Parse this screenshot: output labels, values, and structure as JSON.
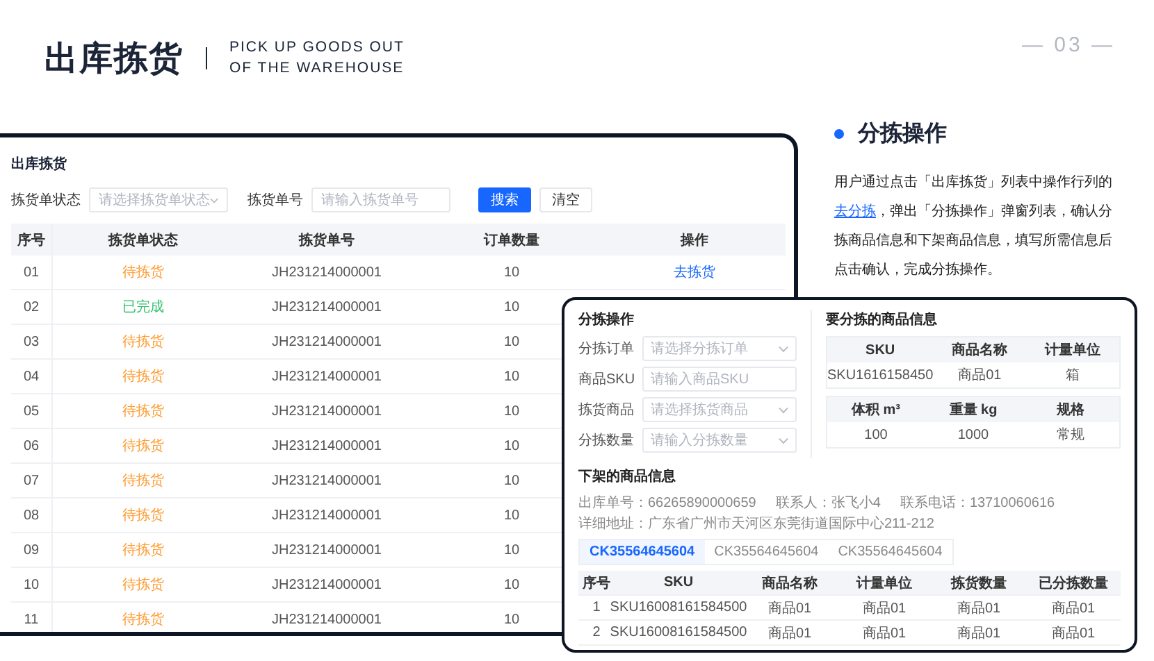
{
  "header": {
    "title": "出库拣货",
    "subtitle_lines": [
      "PICK UP GOODS OUT",
      "OF THE WAREHOUSE"
    ],
    "page_number": "— 03 —"
  },
  "list_window": {
    "title": "出库拣货",
    "filters": [
      {
        "label": "拣货单状态",
        "placeholder": "请选择拣货单状态",
        "kind": "select"
      },
      {
        "label": "拣货单号",
        "placeholder": "请输入拣货单号",
        "kind": "input"
      }
    ],
    "buttons": [
      {
        "label": "搜索",
        "kind": "primary"
      },
      {
        "label": "清空",
        "kind": "plain"
      }
    ],
    "table": {
      "columns": [
        "序号",
        "拣货单状态",
        "拣货单号",
        "订单数量",
        "操作"
      ],
      "rows": [
        {
          "index": "01",
          "status": "待拣货",
          "color": "#ff9a2e",
          "order_no": "JH231214000001",
          "quantity": "10",
          "action": "去拣货"
        },
        {
          "index": "02",
          "status": "已完成",
          "color": "#2fc26b",
          "order_no": "JH231214000001",
          "quantity": "10"
        },
        {
          "index": "03",
          "status": "待拣货",
          "color": "#ff9a2e",
          "order_no": "JH231214000001",
          "quantity": "10"
        },
        {
          "index": "04",
          "status": "待拣货",
          "color": "#ff9a2e",
          "order_no": "JH231214000001",
          "quantity": "10"
        },
        {
          "index": "05",
          "status": "待拣货",
          "color": "#ff9a2e",
          "order_no": "JH231214000001",
          "quantity": "10"
        },
        {
          "index": "06",
          "status": "待拣货",
          "color": "#ff9a2e",
          "order_no": "JH231214000001",
          "quantity": "10"
        },
        {
          "index": "07",
          "status": "待拣货",
          "color": "#ff9a2e",
          "order_no": "JH231214000001",
          "quantity": "10"
        },
        {
          "index": "08",
          "status": "待拣货",
          "color": "#ff9a2e",
          "order_no": "JH231214000001",
          "quantity": "10"
        },
        {
          "index": "09",
          "status": "待拣货",
          "color": "#ff9a2e",
          "order_no": "JH231214000001",
          "quantity": "10"
        },
        {
          "index": "10",
          "status": "待拣货",
          "color": "#ff9a2e",
          "order_no": "JH231214000001",
          "quantity": "10"
        },
        {
          "index": "11",
          "status": "待拣货",
          "color": "#ff9a2e",
          "order_no": "JH231214000001",
          "quantity": "10"
        }
      ]
    }
  },
  "dialog": {
    "title": "分拣操作",
    "form": [
      {
        "label": "分拣订单",
        "placeholder": "请选择分拣订单",
        "kind": "select"
      },
      {
        "label": "商品SKU",
        "placeholder": "请输入商品SKU",
        "kind": "input"
      },
      {
        "label": "拣货商品",
        "placeholder": "请选择拣货商品",
        "kind": "select"
      },
      {
        "label": "分拣数量",
        "placeholder": "请输入分拣数量",
        "kind": "select"
      }
    ],
    "goods_title": "要分拣的商品信息",
    "goods_tables": [
      {
        "columns": [
          "SKU",
          "商品名称",
          "计量单位"
        ],
        "row": [
          "SKU1616158450",
          "商品01",
          "箱"
        ]
      },
      {
        "columns": [
          "体积 m³",
          "重量 kg",
          "规格"
        ],
        "row": [
          "100",
          "1000",
          "常规"
        ]
      }
    ],
    "shelf": {
      "title": "下架的商品信息",
      "info": [
        "出库单号：66265890000659",
        "联系人：张飞小4",
        "联系电话：13710060616",
        "详细地址：广东省广州市天河区东莞街道国际中心211-212"
      ],
      "tabs": [
        {
          "label": "CK35564645604",
          "selected": true
        },
        {
          "label": "CK35564645604",
          "selected": false
        },
        {
          "label": "CK35564645604",
          "selected": false
        }
      ],
      "table": {
        "columns": [
          "序号",
          "SKU",
          "商品名称",
          "计量单位",
          "拣货数量",
          "已分拣数量"
        ],
        "rows": [
          [
            "1",
            "SKU16008161584500",
            "商品01",
            "商品01",
            "商品01",
            "商品01"
          ],
          [
            "2",
            "SKU16008161584500",
            "商品01",
            "商品01",
            "商品01",
            "商品01"
          ]
        ]
      }
    }
  },
  "note": {
    "title": "分拣操作",
    "text_before": "用户通过点击「出库拣货」列表中操作行列的",
    "link": "去分拣",
    "text_after": "，弹出「分拣操作」弹窗列表，确认分拣商品信息和下架商品信息，填写所需信息后点击确认，完成分拣操作。"
  }
}
